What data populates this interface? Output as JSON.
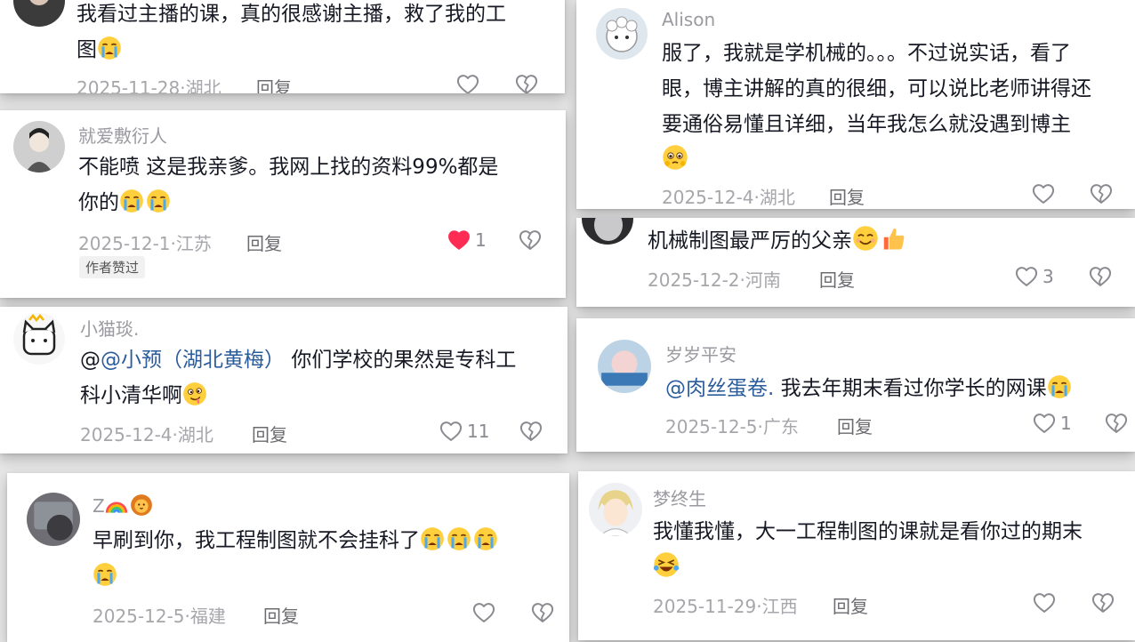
{
  "comments": {
    "c1": {
      "text_a": "我看过主播的课，真的很感谢主播，救了我的工",
      "text_b": "图",
      "emoji": "crying-face",
      "date_loc": "2025-11-28·湖北",
      "reply": "回复"
    },
    "c2": {
      "user": "就爱敷衍人",
      "text_a": "不能喷 这是我亲爹。我网上找的资料99%都是",
      "text_b": "你的",
      "emoji": "crying-face",
      "date_loc": "2025-12-1·江苏",
      "reply": "回复",
      "likes": "1",
      "badge": "作者赞过",
      "liked_color": "#fe2c55"
    },
    "c3": {
      "user": "小猫琰.",
      "at": "@",
      "mention": "@小预（湖北黄梅）",
      "text_a": "你们学校的果然是专科工",
      "text_b": "科小清华啊",
      "emoji": "drooling-face",
      "date_loc": "2025-12-4·湖北",
      "reply": "回复",
      "likes": "11"
    },
    "c4": {
      "user": "Z",
      "user_emojis": [
        "rainbow",
        "lion"
      ],
      "text_a": "早刷到你，我工程制图就不会挂科了",
      "emoji": "crying-face",
      "date_loc": "2025-12-5·福建",
      "reply": "回复"
    },
    "c5": {
      "user": "Alison",
      "text_a": "服了，我就是学机械的。。。不过说实话，看了",
      "text_b": "眼，博主讲解的真的很细，可以说比老师讲得还",
      "text_c": "要通俗易懂且详细，当年我怎么就没遇到博主",
      "emoji": "holding-back-tears",
      "date_loc": "2025-12-4·湖北",
      "reply": "回复"
    },
    "c6": {
      "text_a": "机械制图最严厉的父亲",
      "emojis": [
        "smiling-face",
        "thumbs-up"
      ],
      "date_loc": "2025-12-2·河南",
      "reply": "回复",
      "likes": "3"
    },
    "c7": {
      "user": "岁岁平安",
      "mention": "@肉丝蛋卷.",
      "text_a": "我去年期末看过你学长的网课",
      "emoji": "crying-face",
      "date_loc": "2025-12-5·广东",
      "reply": "回复",
      "likes": "1"
    },
    "c8": {
      "user": "梦终生",
      "text_a": "我懂我懂，大一工程制图的课就是看你过的期末",
      "emoji": "laughing-tears",
      "date_loc": "2025-11-29·江西",
      "reply": "回复"
    }
  }
}
